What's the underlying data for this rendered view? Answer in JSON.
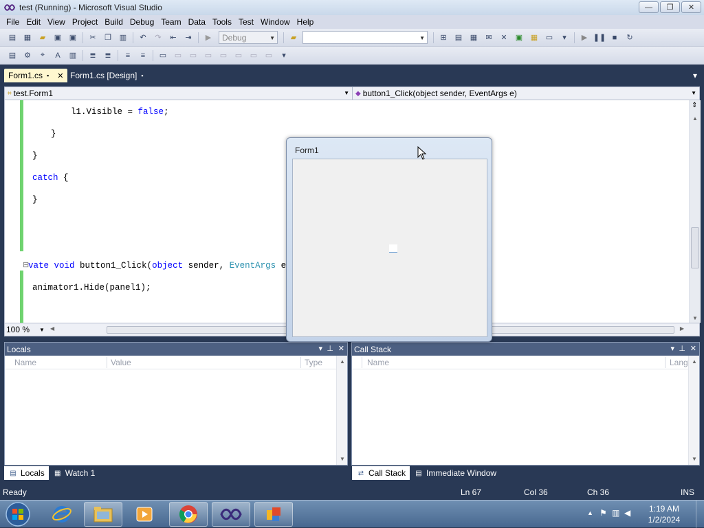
{
  "window": {
    "title": "test (Running) - Microsoft Visual Studio",
    "min": "—",
    "max": "❐",
    "close": "✕"
  },
  "menu": [
    "File",
    "Edit",
    "View",
    "Project",
    "Build",
    "Debug",
    "Team",
    "Data",
    "Tools",
    "Test",
    "Window",
    "Help"
  ],
  "toolbar": {
    "config": "Debug",
    "platform": ""
  },
  "tabs": [
    {
      "label": "Form1.cs",
      "pin": "▪",
      "close": "✕"
    },
    {
      "label": "Form1.cs [Design]",
      "pin": "▪"
    }
  ],
  "tabs_menu": "▾",
  "navbar": {
    "type": "test.Form1",
    "member": "button1_Click(object sender, EventArgs e)"
  },
  "code": {
    "l1_a": "l1.Visible = ",
    "l1_b": "false",
    "l1_c": ";",
    "l2": "}",
    "l3": "}",
    "l4_a": "catch",
    "l4_b": " {",
    "l5": "}",
    "l6_a": "vate ",
    "l6_b": "void",
    "l6_c": " button1_Click(",
    "l6_d": "object",
    "l6_e": " sender, ",
    "l6_f": "EventArgs",
    "l6_g": " e)",
    "l7": "animator1.Hide(panel1);",
    "collapse": "⊟"
  },
  "zoom": "100 %",
  "form1": {
    "title": "Form1"
  },
  "locals": {
    "title": "Locals",
    "cols": [
      "Name",
      "Value",
      "Type"
    ]
  },
  "callstack": {
    "title": "Call Stack",
    "cols": [
      "Name",
      "Lang"
    ]
  },
  "bottom_tabs_left": [
    "Locals",
    "Watch 1"
  ],
  "bottom_tabs_right": [
    "Call Stack",
    "Immediate Window"
  ],
  "status": {
    "ready": "Ready",
    "ln": "Ln 67",
    "col": "Col 36",
    "ch": "Ch 36",
    "ins": "INS"
  },
  "clock": {
    "time": "1:19 AM",
    "date": "1/2/2024"
  },
  "colors": {
    "accent": "#293955",
    "tab_active": "#fff7cf",
    "toolwin_header": "#4d6082",
    "keyword": "#0000ff",
    "type": "#2b91af",
    "changed_margin": "#6fd36f"
  }
}
